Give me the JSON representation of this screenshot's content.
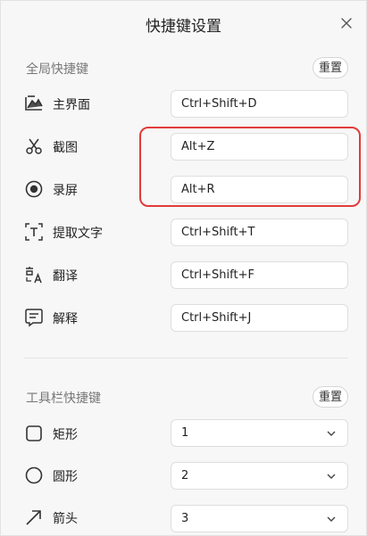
{
  "window": {
    "title": "快捷键设置"
  },
  "global_section": {
    "title": "全局快捷键",
    "reset_label": "重置",
    "items": [
      {
        "label": "主界面",
        "value": "Ctrl+Shift+D",
        "icon": "main-window-icon"
      },
      {
        "label": "截图",
        "value": "Alt+Z",
        "icon": "scissors-icon"
      },
      {
        "label": "录屏",
        "value": "Alt+R",
        "icon": "record-icon"
      },
      {
        "label": "提取文字",
        "value": "Ctrl+Shift+T",
        "icon": "text-extract-icon"
      },
      {
        "label": "翻译",
        "value": "Ctrl+Shift+F",
        "icon": "translate-icon"
      },
      {
        "label": "解释",
        "value": "Ctrl+Shift+J",
        "icon": "explain-icon"
      }
    ]
  },
  "toolbar_section": {
    "title": "工具栏快捷键",
    "reset_label": "重置",
    "items": [
      {
        "label": "矩形",
        "value": "1",
        "icon": "rectangle-icon"
      },
      {
        "label": "圆形",
        "value": "2",
        "icon": "circle-icon"
      },
      {
        "label": "箭头",
        "value": "3",
        "icon": "arrow-icon"
      }
    ]
  },
  "colors": {
    "highlight": "#e23b3b",
    "background": "#f7f7f7",
    "field_bg": "#ffffff"
  }
}
